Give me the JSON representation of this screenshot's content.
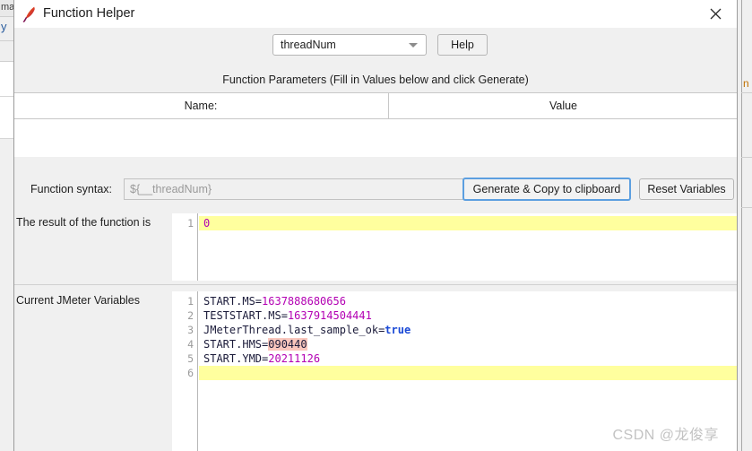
{
  "window": {
    "title": "Function Helper",
    "icon": "jmeter-feather-icon",
    "close_label": "✕"
  },
  "toolbar": {
    "function_select_value": "threadNum",
    "function_select_icon": "chevron-down-icon",
    "help_label": "Help"
  },
  "parameters": {
    "section_title": "Function Parameters (Fill in Values below and click Generate)",
    "columns": [
      "Name:",
      "Value"
    ],
    "rows": []
  },
  "syntax": {
    "label": "Function syntax:",
    "placeholder": "${__threadNum}",
    "value": "",
    "generate_label": "Generate & Copy to clipboard",
    "reset_label": "Reset Variables"
  },
  "result": {
    "label": "The result of the function is",
    "line_numbers": [
      "1"
    ],
    "lines": [
      {
        "n": "1",
        "highlight": true,
        "tokens": [
          {
            "t": "0",
            "c": "num"
          }
        ]
      }
    ]
  },
  "variables": {
    "label": "Current JMeter Variables",
    "line_numbers": [
      "1",
      "2",
      "3",
      "4",
      "5",
      "6"
    ],
    "lines": [
      {
        "n": "1",
        "highlight": false,
        "tokens": [
          {
            "t": "START.MS=",
            "c": "key"
          },
          {
            "t": "1637888680656",
            "c": "num"
          }
        ]
      },
      {
        "n": "2",
        "highlight": false,
        "tokens": [
          {
            "t": "TESTSTART.MS=",
            "c": "key"
          },
          {
            "t": "1637914504441",
            "c": "num"
          }
        ]
      },
      {
        "n": "3",
        "highlight": false,
        "tokens": [
          {
            "t": "JMeterThread.last_sample_ok=",
            "c": "key"
          },
          {
            "t": "true",
            "c": "bool"
          }
        ]
      },
      {
        "n": "4",
        "highlight": false,
        "tokens": [
          {
            "t": "START.HMS=",
            "c": "key"
          },
          {
            "t": "090440",
            "c": "mark"
          }
        ]
      },
      {
        "n": "5",
        "highlight": false,
        "tokens": [
          {
            "t": "START.YMD=",
            "c": "key"
          },
          {
            "t": "20211126",
            "c": "num"
          }
        ]
      },
      {
        "n": "6",
        "highlight": true,
        "tokens": []
      }
    ]
  },
  "background": {
    "left_fragments": [
      "ma",
      "y"
    ],
    "right_fragments": [
      "n"
    ]
  },
  "watermark": {
    "text": "CSDN @龙俊享"
  },
  "colors": {
    "accent_focus": "#5c9fe0",
    "highlight_yellow": "#ffff9e",
    "search_match": "#fac7bd",
    "number_token": "#b300b3",
    "boolean_token": "#1a49d6",
    "dialog_bg": "#f0f0f0"
  }
}
